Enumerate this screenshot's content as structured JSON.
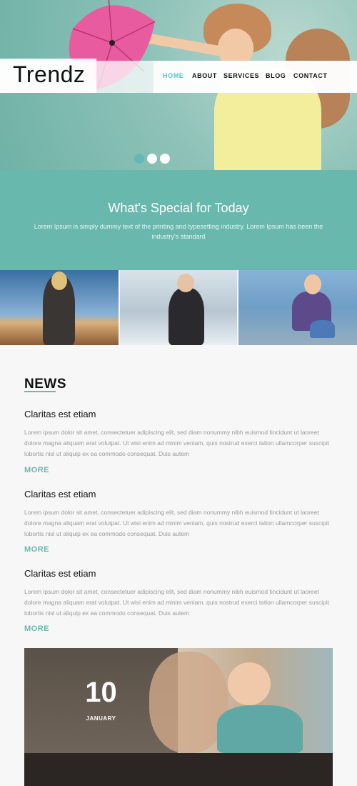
{
  "brand": {
    "logo_text": "Trendz"
  },
  "nav": {
    "items": [
      {
        "label": "HOME",
        "active": true
      },
      {
        "label": "ABOUT",
        "active": false
      },
      {
        "label": "SERVICES",
        "active": false
      },
      {
        "label": "BLOG",
        "active": false
      },
      {
        "label": "CONTACT",
        "active": false
      }
    ]
  },
  "slider": {
    "dot_count": 3,
    "active_index": 0
  },
  "special": {
    "title": "What's Special for Today",
    "text": "Lorem Ipsum is simply dummy text of the printing and typesetting industry. Lorem Ipsum has been the industry's standard"
  },
  "news": {
    "heading": "NEWS",
    "articles": [
      {
        "title": "Claritas est etiam",
        "body": "Lorem ipsum dolor sit amet, consectetuer adipiscing elit, sed diam nonummy nibh euismod tincidunt ut laoreet dolore magna aliquam erat volutpat. Ut wisi enim ad minim veniam, quis nostrud exerci tation ullamcorper suscipit lobortis nisl ut aliquip ex ea commodo consequat. Duis autem",
        "more": "MORE"
      },
      {
        "title": "Claritas est etiam",
        "body": "Lorem ipsum dolor sit amet, consectetuer adipiscing elit, sed diam nonummy nibh euismod tincidunt ut laoreet dolore magna aliquam erat volutpat. Ut wisi enim ad minim veniam, quis nostrud exerci tation ullamcorper suscipit lobortis nisl ut aliquip ex ea commodo consequat. Duis autem",
        "more": "MORE"
      },
      {
        "title": "Claritas est etiam",
        "body": "Lorem ipsum dolor sit amet, consectetuer adipiscing elit, sed diam nonummy nibh euismod tincidunt ut laoreet dolore magna aliquam erat volutpat. Ut wisi enim ad minim veniam, quis nostrud exerci tation ullamcorper suscipit lobortis nisl ut aliquip ex ea commodo consequat. Duis autem",
        "more": "MORE"
      }
    ]
  },
  "event": {
    "day": "10",
    "month": "JANUARY"
  },
  "colors": {
    "accent": "#69b8ad",
    "nav_active": "#5cc1c7"
  }
}
